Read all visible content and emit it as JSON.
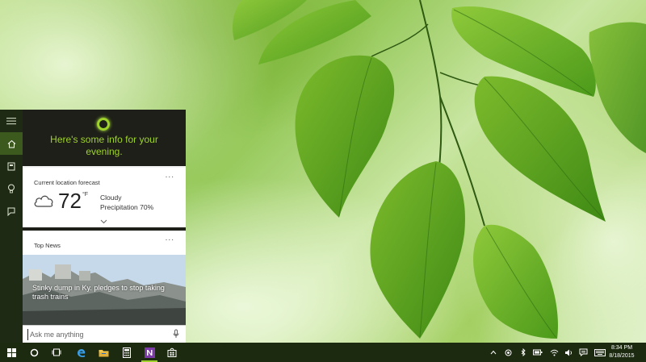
{
  "cortana": {
    "greeting_line1": "Here's some info for your",
    "greeting_line2": "evening.",
    "rail": [
      {
        "icon": "hamburger-icon"
      },
      {
        "icon": "home-icon"
      },
      {
        "icon": "notebook-icon"
      },
      {
        "icon": "lightbulb-icon"
      },
      {
        "icon": "feedback-icon"
      }
    ],
    "weather_card": {
      "label": "Current location forecast",
      "menu": "...",
      "temperature": "72",
      "unit": "°F",
      "condition": "Cloudy",
      "precipitation": "Precipitation 70%"
    },
    "news_card": {
      "label": "Top News",
      "menu": "...",
      "headline": "Stinky dump in Ky. pledges to stop taking trash trains"
    },
    "search": {
      "placeholder": "Ask me anything"
    }
  },
  "taskbar": {
    "apps": [
      {
        "icon": "windows-start-icon"
      },
      {
        "icon": "cortana-search-icon"
      },
      {
        "icon": "task-view-icon"
      },
      {
        "icon": "edge-icon"
      },
      {
        "icon": "file-explorer-icon"
      },
      {
        "icon": "calculator-icon"
      },
      {
        "icon": "onenote-icon"
      },
      {
        "icon": "store-icon"
      }
    ],
    "clock_time": "8:34 PM",
    "clock_date": "8/18/2015"
  },
  "colors": {
    "accent": "#9fd32b",
    "taskbar": "#1c2a10",
    "panel_header": "#1d1f18"
  }
}
